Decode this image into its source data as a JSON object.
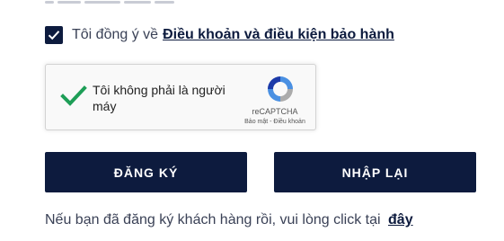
{
  "terms": {
    "checked": true,
    "text": "Tôi đồng ý về",
    "link": "Điều khoản và điều kiện bảo hành"
  },
  "recaptcha": {
    "label": "Tôi không phải là người máy",
    "brand": "reCAPTCHA",
    "links": "Bảo mật - Điều khoản",
    "icon": "recaptcha-logo-icon",
    "check_color": "#1e9e57"
  },
  "buttons": {
    "register": "ĐĂNG KÝ",
    "reset": "NHẬP LẠI"
  },
  "login": {
    "text": "Nếu bạn đã đăng ký khách hàng rồi, vui lòng click tại",
    "link": "đây"
  },
  "colors": {
    "primary": "#0d1b3e",
    "text": "#3a4156"
  }
}
